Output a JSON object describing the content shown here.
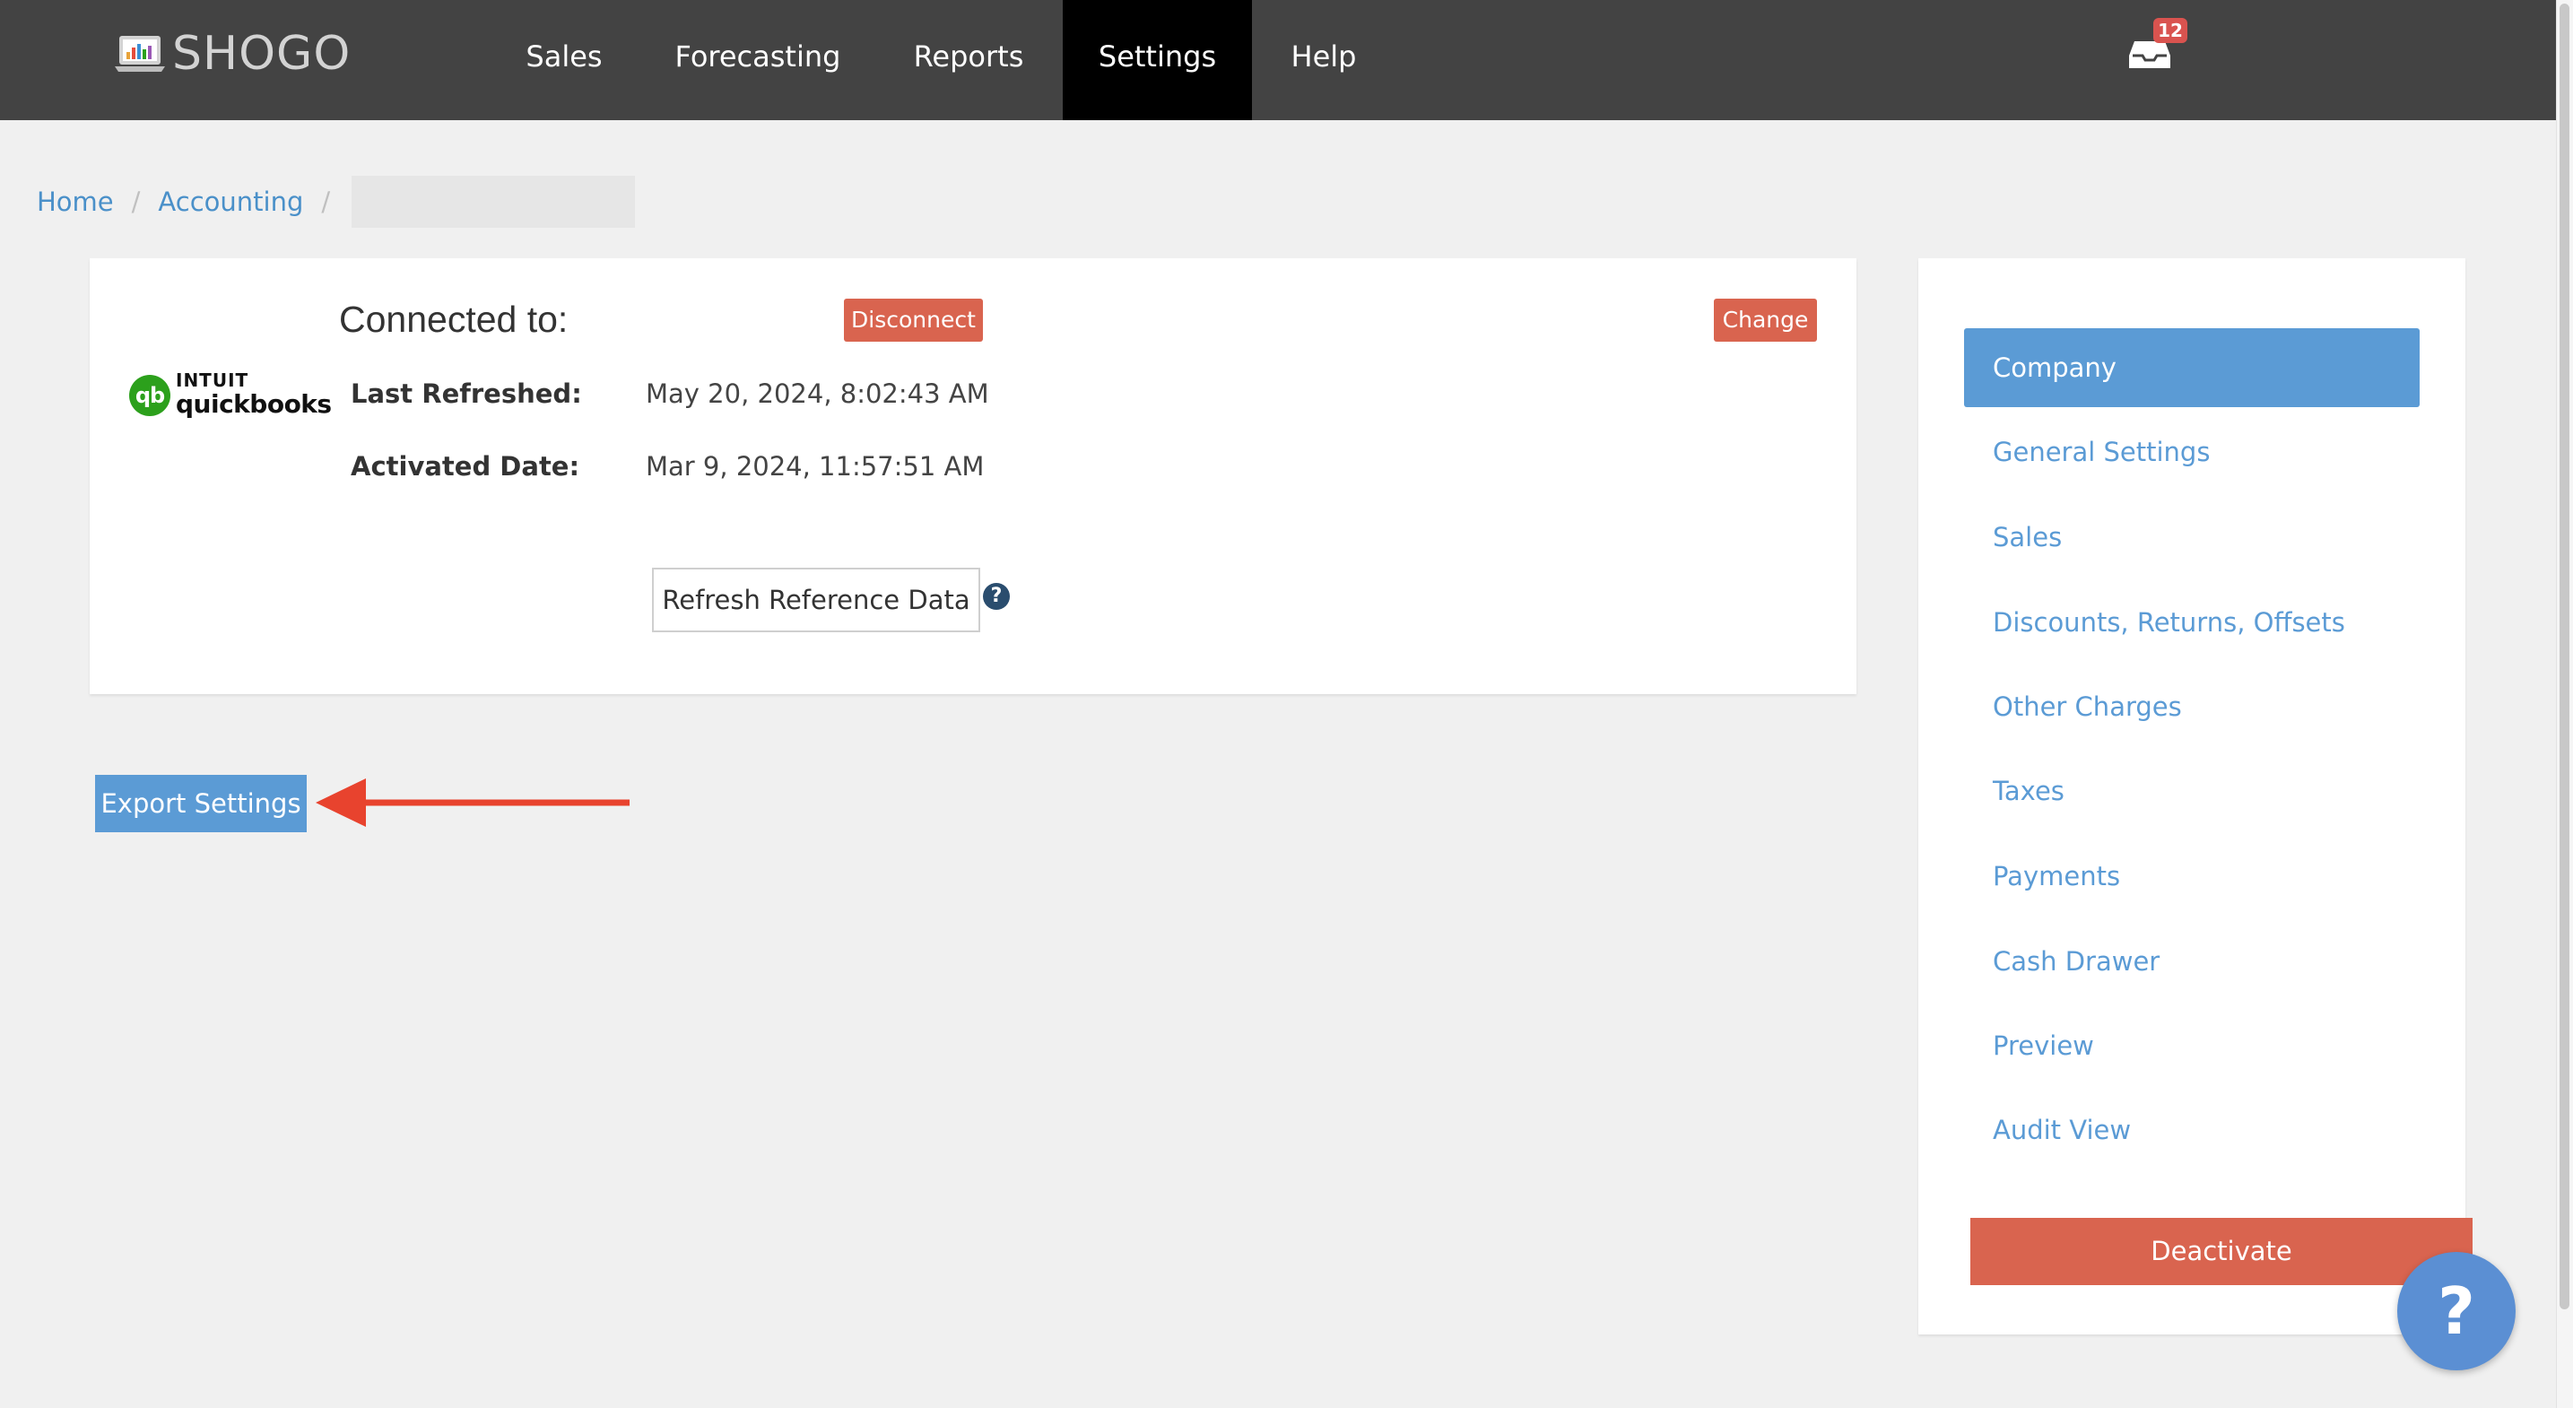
{
  "brand": {
    "name": "SHOGO"
  },
  "nav": {
    "items": [
      {
        "label": "Sales"
      },
      {
        "label": "Forecasting"
      },
      {
        "label": "Reports"
      },
      {
        "label": "Settings",
        "active": true
      },
      {
        "label": "Help"
      }
    ],
    "inbox_count": "12"
  },
  "breadcrumb": {
    "items": [
      "Home",
      "Accounting"
    ],
    "separator": "/"
  },
  "connection": {
    "provider_line1": "INTUIT",
    "provider_line2": "quickbooks",
    "provider_icon_text": "qb",
    "title": "Connected to:",
    "disconnect_label": "Disconnect",
    "change_label": "Change",
    "last_refreshed_label": "Last Refreshed:",
    "last_refreshed_value": "May 20, 2024, 8:02:43 AM",
    "activated_label": "Activated Date:",
    "activated_value": "Mar 9, 2024, 11:57:51 AM",
    "refresh_label": "Refresh Reference Data",
    "help_glyph": "?"
  },
  "export": {
    "label": "Export Settings"
  },
  "sidebar": {
    "items": [
      {
        "label": "Company",
        "active": true
      },
      {
        "label": "General Settings"
      },
      {
        "label": "Sales"
      },
      {
        "label": "Discounts, Returns, Offsets"
      },
      {
        "label": "Other Charges"
      },
      {
        "label": "Taxes"
      },
      {
        "label": "Payments"
      },
      {
        "label": "Cash Drawer"
      },
      {
        "label": "Preview"
      },
      {
        "label": "Audit View"
      }
    ],
    "deactivate_label": "Deactivate"
  },
  "floating_help": {
    "glyph": "?"
  },
  "colors": {
    "nav_bg": "#434343",
    "nav_active": "#000000",
    "accent_blue": "#5b9bd5",
    "danger_red": "#d9644f",
    "annotation_arrow": "#e8432e",
    "quickbooks_green": "#2ca01c"
  },
  "icons": {
    "logo": "laptop-chart-icon",
    "inbox": "inbox-tray-icon",
    "help": "question-circle-icon",
    "arrow": "left-arrow-annotation-icon"
  }
}
